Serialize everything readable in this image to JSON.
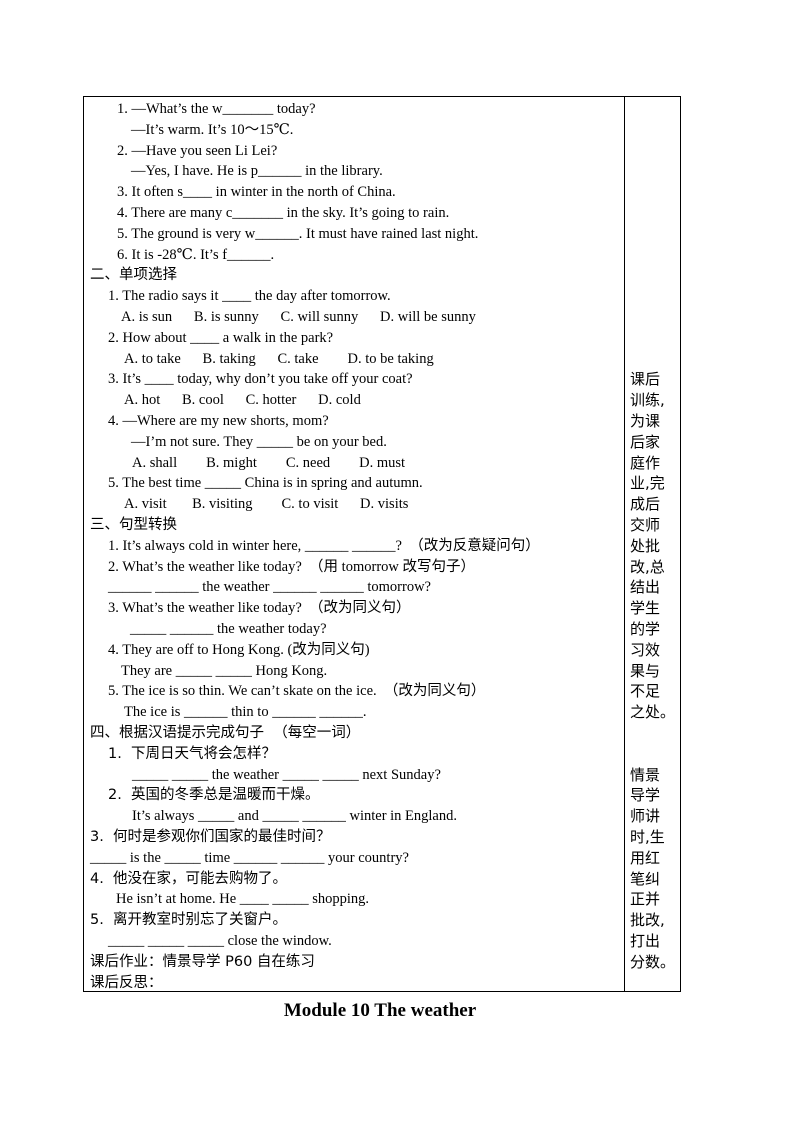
{
  "page_title": "Module 10 The weather",
  "lines": [
    {
      "indent": 33,
      "text": "1. —What’s the w_______ today?"
    },
    {
      "indent": 47,
      "text": "—It’s warm. It’s 10～15℃."
    },
    {
      "indent": 33,
      "text": "2. —Have you seen Li Lei?"
    },
    {
      "indent": 47,
      "text": "—Yes, I have. He is p______ in the library."
    },
    {
      "indent": 33,
      "text": "3. It often s____ in winter in the north of China."
    },
    {
      "indent": 33,
      "text": "4. There are many c_______ in the sky. It’s going to rain."
    },
    {
      "indent": 33,
      "text": "5. The ground is very w______. It must have rained last night."
    },
    {
      "indent": 33,
      "text": "6. It is -28℃. It’s f______."
    },
    {
      "indent": 6,
      "text": "二、单项选择",
      "cn": true
    },
    {
      "indent": 24,
      "text": "1. The radio says it ____ the day after tomorrow."
    },
    {
      "indent": 37,
      "text": "A. is sun      B. is sunny      C. will sunny      D. will be sunny"
    },
    {
      "indent": 24,
      "text": "2. How about ____ a walk in the park?"
    },
    {
      "indent": 40,
      "text": "A. to take      B. taking      C. take        D. to be taking"
    },
    {
      "indent": 24,
      "text": "3. It’s ____ today, why don’t you take off your coat?"
    },
    {
      "indent": 40,
      "text": "A. hot      B. cool      C. hotter      D. cold"
    },
    {
      "indent": 24,
      "text": "4. —Where are my new shorts, mom?"
    },
    {
      "indent": 47,
      "text": "—I’m not sure. They _____ be on your bed."
    },
    {
      "indent": 48,
      "text": "A. shall        B. might        C. need        D. must"
    },
    {
      "indent": 24,
      "text": "5. The best time _____ China is in spring and autumn."
    },
    {
      "indent": 40,
      "text": "A. visit       B. visiting        C. to visit      D. visits"
    },
    {
      "indent": 6,
      "text": "三、句型转换",
      "cn": true
    },
    {
      "indent": 24,
      "text": "1. It’s always cold in winter here, ______ ______?  （改为反意疑问句）"
    },
    {
      "indent": 24,
      "text": "2. What’s the weather like today?  （用 tomorrow 改写句子）"
    },
    {
      "indent": 24,
      "text": "______ ______ the weather ______ ______ tomorrow?"
    },
    {
      "indent": 24,
      "text": "3. What’s the weather like today?  （改为同义句）"
    },
    {
      "indent": 46,
      "text": "_____ ______ the weather today?"
    },
    {
      "indent": 24,
      "text": "4. They are off to Hong Kong. (改为同义句)"
    },
    {
      "indent": 37,
      "text": "They are _____ _____ Hong Kong."
    },
    {
      "indent": 24,
      "text": "5. The ice is so thin. We can’t skate on the ice.  （改为同义句）"
    },
    {
      "indent": 40,
      "text": "The ice is ______ thin to ______ ______."
    },
    {
      "indent": 6,
      "text": "四、根据汉语提示完成句子  （每空一词）",
      "cn": true
    },
    {
      "indent": 24,
      "text": "1.  下周日天气将会怎样？",
      "cn": true
    },
    {
      "indent": 48,
      "text": "_____ _____ the weather _____ _____ next Sunday?"
    },
    {
      "indent": 24,
      "text": "2.  英国的冬季总是温暖而干燥。",
      "cn": true
    },
    {
      "indent": 48,
      "text": "It’s always _____ and _____ ______ winter in England."
    },
    {
      "indent": 6,
      "text": "3.  何时是参观你们国家的最佳时间？",
      "cn": true
    },
    {
      "indent": 6,
      "text": "_____ is the _____ time ______ ______ your country?"
    },
    {
      "indent": 6,
      "text": "4.  他没在家，可能去购物了。",
      "cn": true
    },
    {
      "indent": 32,
      "text": "He isn’t at home. He ____ _____ shopping."
    },
    {
      "indent": 6,
      "text": "5.  离开教室时别忘了关窗户。",
      "cn": true
    },
    {
      "indent": 24,
      "text": "_____ _____ _____ close the window."
    },
    {
      "indent": 6,
      "text": "课后作业：情景导学 P60 自在练习",
      "cn": true
    },
    {
      "indent": 6,
      "text": "课后反思：",
      "cn": true
    }
  ],
  "side_notes": [
    {
      "top_line": 13,
      "lines": [
        "课后",
        "训练,",
        "为课",
        "后家",
        "庭作",
        "业,完",
        "成后",
        "交师",
        "处批",
        "改,总",
        "结出",
        "学生",
        "的学",
        "习效",
        "果与",
        "不足",
        "之处。"
      ]
    },
    {
      "top_line": 32,
      "lines": [
        "情景",
        "导学",
        "师讲",
        "时,生",
        "用红",
        "笔纠",
        "正并",
        "批改,",
        "打出",
        "分数。"
      ]
    }
  ]
}
